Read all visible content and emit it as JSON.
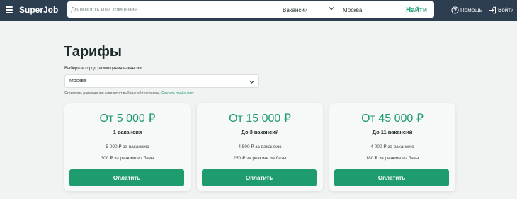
{
  "header": {
    "logo": "SuperJob",
    "search_placeholder": "Должность или компания",
    "search_type": "Вакансии",
    "search_city": "Москва",
    "search_button": "Найти",
    "help": "Помощь",
    "login": "Войти"
  },
  "page": {
    "title": "Тарифы",
    "city_label": "Выберите город размещения вакансии",
    "city_value": "Москва",
    "note": "Стоимость размещения зависит от выбранной географии.",
    "note_link": "Скачать прайс-лист"
  },
  "tariffs": [
    {
      "price": "От 5 000 ₽",
      "title": "1 вакансия",
      "line1": "5 000 ₽ за вакансию",
      "line2": "300 ₽ за резюме из базы",
      "button": "Оплатить"
    },
    {
      "price": "От 15 000 ₽",
      "title": "До 3 вакансий",
      "line1": "4 500 ₽ за вакансию",
      "line2": "250 ₽ за резюме из базы",
      "button": "Оплатить"
    },
    {
      "price": "От 45 000 ₽",
      "title": "До 11 вакансий",
      "line1": "4 000 ₽ за вакансию",
      "line2": "180 ₽ за резюме из базы",
      "button": "Оплатить"
    }
  ],
  "colors": {
    "header_bg": "#2c3e50",
    "accent": "#1f9c6e",
    "page_bg": "#f1f2f2"
  },
  "icons": {
    "menu": "menu-icon",
    "dropdown": "chevron-down-icon",
    "help": "help-circle-icon",
    "login": "login-icon"
  }
}
